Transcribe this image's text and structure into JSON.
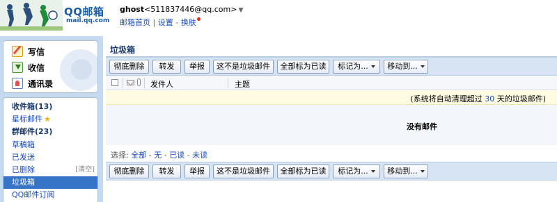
{
  "header": {
    "logo_text": "QQ邮箱",
    "logo_sub": "mail.qq.com",
    "user_name": "ghost",
    "user_email": "<511837446@qq.com>",
    "nav_home": "邮箱首页",
    "nav_sep": "|",
    "nav_settings": "设置",
    "nav_dash": "-",
    "nav_skin": "换肤"
  },
  "quick": {
    "write": "写信",
    "receive": "收信",
    "contacts": "通讯录"
  },
  "folders": {
    "inbox": "收件箱(13)",
    "starred": "星标邮件",
    "star_glyph": "★",
    "group": "群邮件(23)",
    "drafts": "草稿箱",
    "sent": "已发送",
    "deleted": "已删除",
    "clear": "[清空]",
    "junk": "垃圾箱",
    "subscribe": "QQ邮件订阅"
  },
  "main": {
    "title": "垃圾箱",
    "toolbar": {
      "delete_perm": "彻底删除",
      "forward": "转发",
      "report": "举报",
      "not_junk": "这不是垃圾邮件",
      "mark_all_read": "全部标为已读",
      "mark_as": "标记为...",
      "move_to": "移动到..."
    },
    "columns": {
      "sender": "发件人",
      "subject": "主题"
    },
    "notice_prefix": "(系统将自动清理超过",
    "notice_days": "30",
    "notice_suffix": "天的垃圾邮件)",
    "empty": "没有邮件",
    "select": {
      "label": "选择:",
      "all": "全部",
      "none": "无",
      "read": "已读",
      "unread": "未读",
      "dash": "-"
    }
  },
  "colors": {
    "accent": "#3574c6",
    "sidebar_bg": "#c5d9ef",
    "toolbar_bg": "#d7e4f3",
    "notice_bg": "#fffbe3",
    "link": "#1a4bb5"
  }
}
